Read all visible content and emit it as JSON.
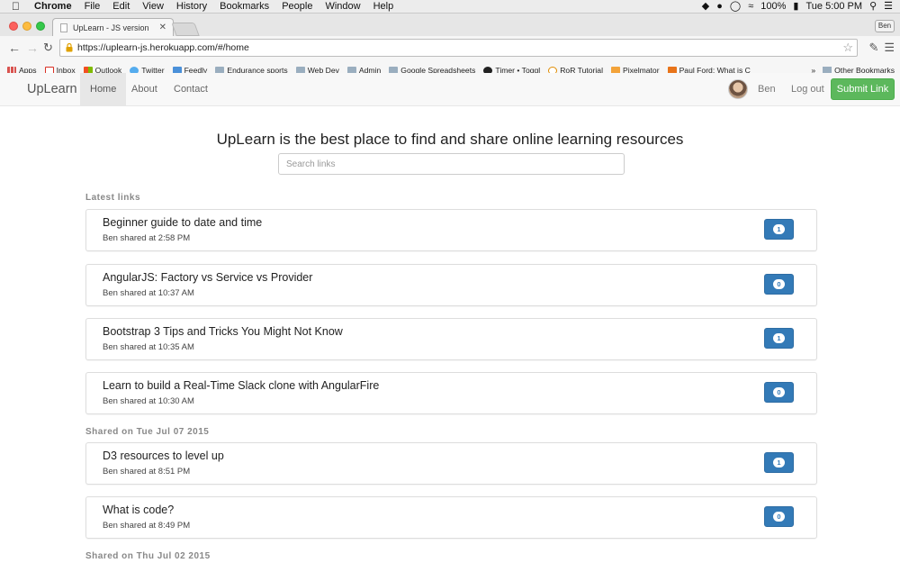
{
  "os_menubar": {
    "app": "Chrome",
    "items": [
      "File",
      "Edit",
      "View",
      "History",
      "Bookmarks",
      "People",
      "Window",
      "Help"
    ],
    "battery": "100%",
    "time": "Tue 5:00 PM"
  },
  "browser": {
    "tab_title": "UpLearn - JS version",
    "profile": "Ben",
    "url": "https://uplearn-js.herokuapp.com/#/home",
    "bookmarks": [
      "Apps",
      "Inbox",
      "Outlook",
      "Twitter",
      "Feedly",
      "Endurance sports",
      "Web Dev",
      "Admin",
      "Google Spreadsheets",
      "Timer • Toggl",
      "RoR Tutorial",
      "Pixelmator",
      "Paul Ford: What is C"
    ],
    "bookmarks_more": "»",
    "other_bookmarks": "Other Bookmarks"
  },
  "navbar": {
    "brand": "UpLearn",
    "links": [
      "Home",
      "About",
      "Contact"
    ],
    "user": "Ben",
    "logout": "Log out",
    "submit": "Submit Link"
  },
  "main": {
    "headline": "UpLearn is the best place to find and share online learning resources",
    "search_placeholder": "Search links",
    "sections": [
      {
        "heading": "Latest links",
        "links": [
          {
            "title": "Beginner guide to date and time",
            "meta": "Ben shared at 2:58 PM",
            "votes": "1"
          },
          {
            "title": "AngularJS: Factory vs Service vs Provider",
            "meta": "Ben shared at 10:37 AM",
            "votes": "0"
          },
          {
            "title": "Bootstrap 3 Tips and Tricks You Might Not Know",
            "meta": "Ben shared at 10:35 AM",
            "votes": "1"
          },
          {
            "title": "Learn to build a Real-Time Slack clone with AngularFire",
            "meta": "Ben shared at 10:30 AM",
            "votes": "0"
          }
        ]
      },
      {
        "heading": "Shared on Tue Jul 07 2015",
        "links": [
          {
            "title": "D3 resources to level up",
            "meta": "Ben shared at 8:51 PM",
            "votes": "1"
          },
          {
            "title": "What is code?",
            "meta": "Ben shared at 8:49 PM",
            "votes": "0"
          }
        ]
      },
      {
        "heading": "Shared on Thu Jul 02 2015",
        "links": []
      }
    ]
  }
}
